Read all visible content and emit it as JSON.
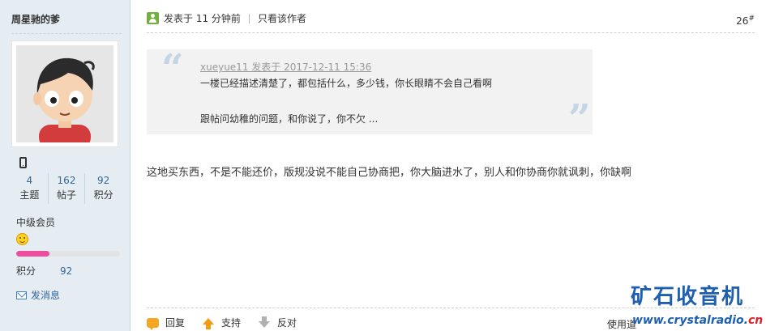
{
  "sidebar": {
    "username": "周星驰的爹",
    "stats": [
      {
        "value": "4",
        "label": "主题"
      },
      {
        "value": "162",
        "label": "帖子"
      },
      {
        "value": "92",
        "label": "积分"
      }
    ],
    "level": "中级会员",
    "level_progress": 0.32,
    "points_label": "积分",
    "points_value": "92",
    "send_message": "发消息"
  },
  "post": {
    "posted_prefix": "发表于",
    "posted_time": "11 分钟前",
    "only_author": "只看该作者",
    "floor": "26",
    "floor_suffix": "#"
  },
  "quote": {
    "author_line": "xueyue11 发表于 2017-12-11 15:36",
    "line1": "一楼已经描述清楚了，都包括什么，多少钱，你长眼睛不会自己看啊",
    "line2": "跟帖问幼稚的问题，和你说了，你不欠 ..."
  },
  "reply_body": "这地买东西，不是不能还价，版规没说不能自己协商把，你大脑进水了，别人和你协商你就讽刺，你缺啊",
  "actions": {
    "reply": "回复",
    "support": "支持",
    "oppose": "反对",
    "use": "使用道"
  },
  "watermark": {
    "title": "矿石收音机",
    "url_main": "www.crystalradio.",
    "url_tld": "cn"
  },
  "colors": {
    "sidebar_bg": "#e5edf2",
    "link_blue": "#336699",
    "progress_pink": "#ec4d9c",
    "watermark_blue": "#1e5fb0",
    "watermark_red": "#d9232a"
  }
}
